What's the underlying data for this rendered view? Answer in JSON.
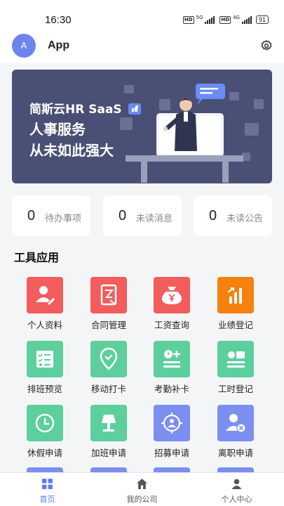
{
  "status": {
    "time": "16:30",
    "net1": "5G",
    "net2": "4G",
    "battery": "91"
  },
  "header": {
    "avatar_letter": "A",
    "title": "App"
  },
  "banner": {
    "line1": "简斯云HR SaaS",
    "line2": "人事服务",
    "line3": "从未如此强大"
  },
  "stats": [
    {
      "count": "0",
      "label": "待办事项"
    },
    {
      "count": "0",
      "label": "未读消息"
    },
    {
      "count": "0",
      "label": "未读公告"
    }
  ],
  "tools_title": "工具应用",
  "tools": [
    {
      "label": "个人资料",
      "icon": "person-edit-icon",
      "color": "#f25c5c"
    },
    {
      "label": "合同管理",
      "icon": "contract-icon",
      "color": "#f25c5c"
    },
    {
      "label": "工资查询",
      "icon": "money-bag-icon",
      "color": "#f25c5c"
    },
    {
      "label": "业绩登记",
      "icon": "bar-chart-icon",
      "color": "#f5820f"
    },
    {
      "label": "排班预览",
      "icon": "checklist-icon",
      "color": "#5ccf9d"
    },
    {
      "label": "移动打卡",
      "icon": "location-pin-icon",
      "color": "#5ccf9d"
    },
    {
      "label": "考勤补卡",
      "icon": "clock-plus-icon",
      "color": "#5ccf9d"
    },
    {
      "label": "工时登记",
      "icon": "timesheet-icon",
      "color": "#5ccf9d"
    },
    {
      "label": "休假申请",
      "icon": "clock-icon",
      "color": "#5ccf9d"
    },
    {
      "label": "加班申请",
      "icon": "lamp-icon",
      "color": "#5ccf9d"
    },
    {
      "label": "招募申请",
      "icon": "recruit-target-icon",
      "color": "#7b8ff0"
    },
    {
      "label": "离职申请",
      "icon": "person-remove-icon",
      "color": "#7b8ff0"
    }
  ],
  "tabs": [
    {
      "label": "首页",
      "icon": "home-grid-icon",
      "active": true
    },
    {
      "label": "我的公司",
      "icon": "building-icon",
      "active": false
    },
    {
      "label": "个人中心",
      "icon": "user-icon",
      "active": false
    }
  ],
  "colors": {
    "accent": "#5b7cf0",
    "banner_bg": "#4a4f75",
    "red": "#f25c5c",
    "orange": "#f5820f",
    "green": "#5ccf9d",
    "blue": "#7b8ff0"
  }
}
